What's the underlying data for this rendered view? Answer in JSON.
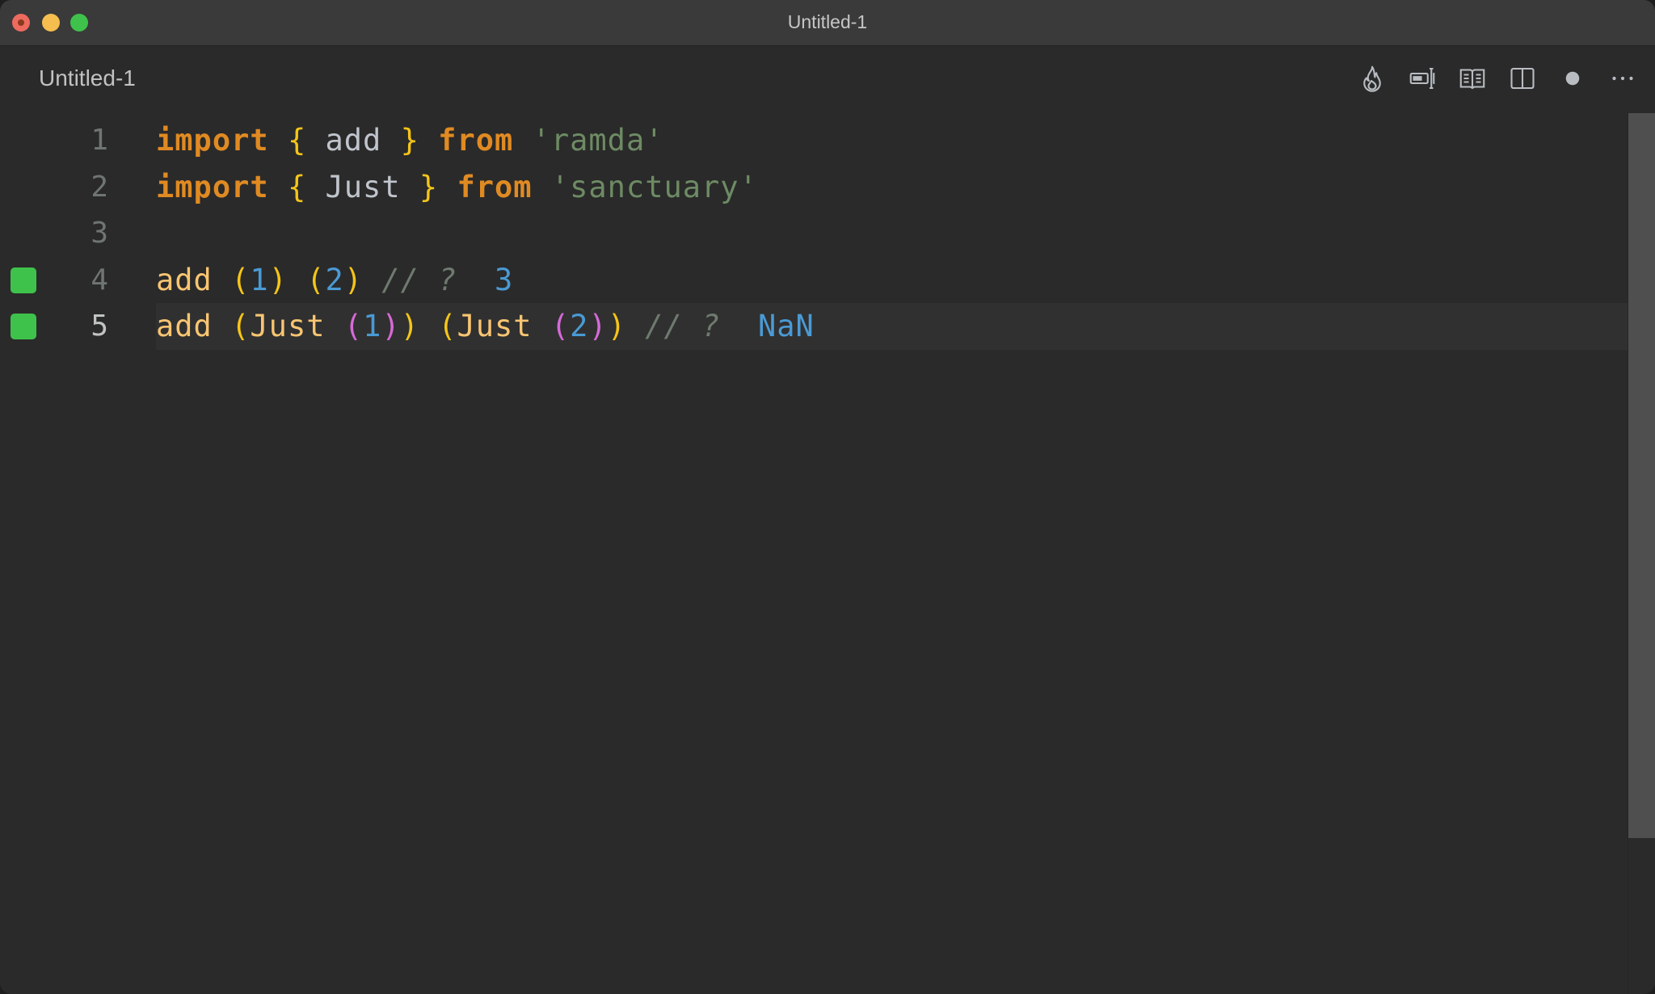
{
  "window": {
    "title": "Untitled-1",
    "controls": [
      "close",
      "minimize",
      "maximize"
    ]
  },
  "tab": {
    "label": "Untitled-1"
  },
  "toolbar": {
    "actions": [
      {
        "icon": "flame-icon",
        "label": "Quokka"
      },
      {
        "icon": "open-changes-icon",
        "label": "Open Changes"
      },
      {
        "icon": "open-preview-icon",
        "label": "Open Preview"
      },
      {
        "icon": "split-editor-icon",
        "label": "Split Editor"
      },
      {
        "icon": "unsaved-dot-icon",
        "label": "Unsaved"
      },
      {
        "icon": "more-actions-icon",
        "label": "More Actions"
      }
    ]
  },
  "editor": {
    "current_line": 5,
    "lines": [
      {
        "number": "1",
        "marker": false,
        "tokens": [
          {
            "t": "import",
            "c": "kw"
          },
          {
            "t": " ",
            "c": "id"
          },
          {
            "t": "{",
            "c": "br1"
          },
          {
            "t": " add ",
            "c": "id"
          },
          {
            "t": "}",
            "c": "br1"
          },
          {
            "t": " ",
            "c": "id"
          },
          {
            "t": "from",
            "c": "kw"
          },
          {
            "t": " ",
            "c": "id"
          },
          {
            "t": "'ramda'",
            "c": "str"
          }
        ]
      },
      {
        "number": "2",
        "marker": false,
        "tokens": [
          {
            "t": "import",
            "c": "kw"
          },
          {
            "t": " ",
            "c": "id"
          },
          {
            "t": "{",
            "c": "br1"
          },
          {
            "t": " Just ",
            "c": "id"
          },
          {
            "t": "}",
            "c": "br1"
          },
          {
            "t": " ",
            "c": "id"
          },
          {
            "t": "from",
            "c": "kw"
          },
          {
            "t": " ",
            "c": "id"
          },
          {
            "t": "'sanctuary'",
            "c": "str"
          }
        ]
      },
      {
        "number": "3",
        "marker": false,
        "tokens": []
      },
      {
        "number": "4",
        "marker": true,
        "tokens": [
          {
            "t": "add",
            "c": "fn"
          },
          {
            "t": " ",
            "c": "id"
          },
          {
            "t": "(",
            "c": "br1"
          },
          {
            "t": "1",
            "c": "num"
          },
          {
            "t": ")",
            "c": "br1"
          },
          {
            "t": " ",
            "c": "id"
          },
          {
            "t": "(",
            "c": "br1"
          },
          {
            "t": "2",
            "c": "num"
          },
          {
            "t": ")",
            "c": "br1"
          },
          {
            "t": " ",
            "c": "id"
          },
          {
            "t": "// ?",
            "c": "cmt"
          },
          {
            "t": "  ",
            "c": "id"
          },
          {
            "t": "3",
            "c": "res"
          }
        ]
      },
      {
        "number": "5",
        "marker": true,
        "tokens": [
          {
            "t": "add",
            "c": "fn"
          },
          {
            "t": " ",
            "c": "id"
          },
          {
            "t": "(",
            "c": "br1"
          },
          {
            "t": "Just",
            "c": "fn"
          },
          {
            "t": " ",
            "c": "id"
          },
          {
            "t": "(",
            "c": "br2"
          },
          {
            "t": "1",
            "c": "num"
          },
          {
            "t": ")",
            "c": "br2"
          },
          {
            "t": ")",
            "c": "br1"
          },
          {
            "t": " ",
            "c": "id"
          },
          {
            "t": "(",
            "c": "br1"
          },
          {
            "t": "Just",
            "c": "fn"
          },
          {
            "t": " ",
            "c": "id"
          },
          {
            "t": "(",
            "c": "br2"
          },
          {
            "t": "2",
            "c": "num"
          },
          {
            "t": ")",
            "c": "br2"
          },
          {
            "t": ")",
            "c": "br1"
          },
          {
            "t": " ",
            "c": "id"
          },
          {
            "t": "// ?",
            "c": "cmt"
          },
          {
            "t": "  ",
            "c": "id"
          },
          {
            "t": "NaN",
            "c": "res"
          }
        ]
      }
    ]
  },
  "colors": {
    "marker_green": "#3fc24b",
    "keyword": "#e08a22",
    "bracket_1": "#f5c518",
    "bracket_2": "#d66ad8",
    "string": "#6e8b64",
    "number": "#4a9ad4",
    "background": "#2a2a2a"
  }
}
